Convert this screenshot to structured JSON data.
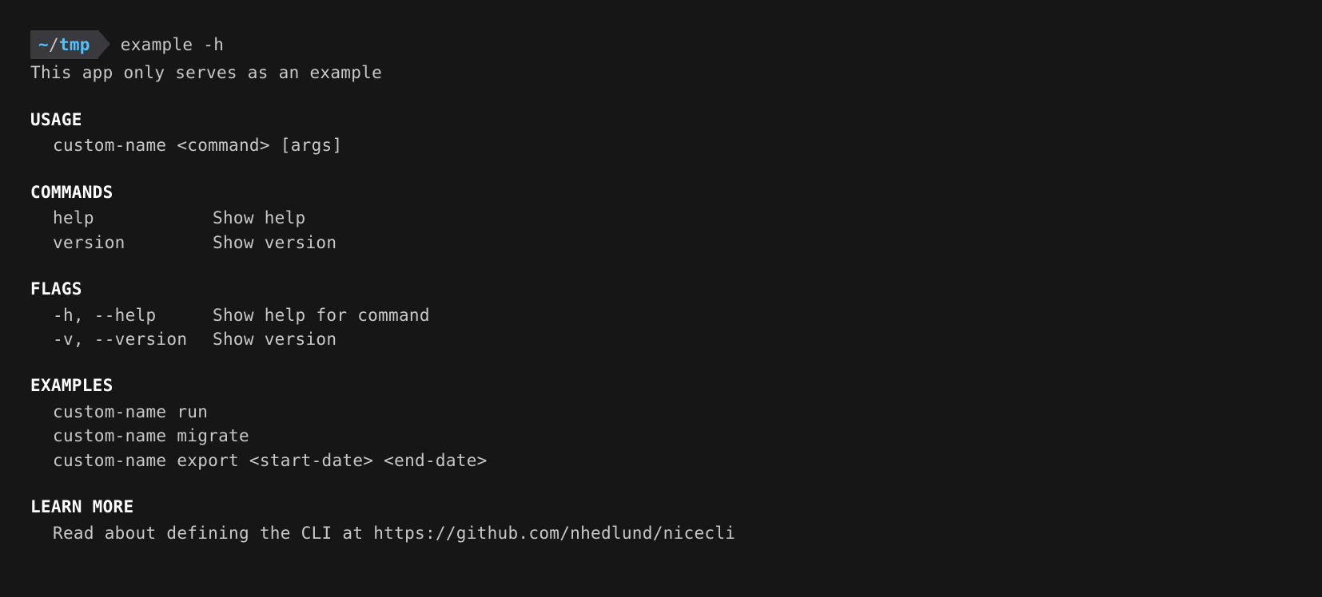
{
  "prompt": {
    "tilde": "~",
    "slash": "/",
    "dir": "tmp",
    "command": "example -h"
  },
  "description": "This app only serves as an example",
  "sections": {
    "usage": {
      "header": "USAGE",
      "line": "custom-name <command> [args]"
    },
    "commands": {
      "header": "COMMANDS",
      "items": [
        {
          "name": "help",
          "desc": "Show help"
        },
        {
          "name": "version",
          "desc": "Show version"
        }
      ]
    },
    "flags": {
      "header": "FLAGS",
      "items": [
        {
          "name": "-h, --help",
          "desc": "Show help for command"
        },
        {
          "name": "-v, --version",
          "desc": "Show version"
        }
      ]
    },
    "examples": {
      "header": "EXAMPLES",
      "lines": [
        "custom-name run",
        "custom-name migrate",
        "custom-name export <start-date> <end-date>"
      ]
    },
    "learnmore": {
      "header": "LEARN MORE",
      "line": "Read about defining the CLI at https://github.com/nhedlund/nicecli"
    }
  }
}
